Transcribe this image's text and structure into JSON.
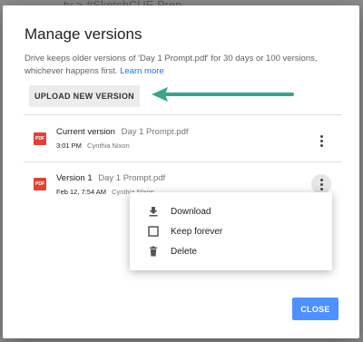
{
  "background": {
    "breadcrumb": "ty  >  #SketchCUE Prep"
  },
  "dialog": {
    "title": "Manage versions",
    "description": "Drive keeps older versions of 'Day 1 Prompt.pdf' for 30 days or 100 versions, whichever happens first.",
    "learn_more": "Learn more",
    "upload_button": "UPLOAD NEW VERSION",
    "annotation_arrow_color": "#3aa58c",
    "versions": [
      {
        "label": "Current version",
        "filename": "Day 1 Prompt.pdf",
        "time": "3:01 PM",
        "author": "Cynthia Nixon",
        "icon": "pdf-icon",
        "icon_text": "PDF"
      },
      {
        "label": "Version 1",
        "filename": "Day 1 Prompt.pdf",
        "time": "Feb 12, 7:54 AM",
        "author": "Cynthia Nixon",
        "icon": "pdf-icon",
        "icon_text": "PDF"
      }
    ],
    "menu": {
      "items": [
        {
          "label": "Download",
          "icon": "download-icon"
        },
        {
          "label": "Keep forever",
          "icon": "checkbox-icon"
        },
        {
          "label": "Delete",
          "icon": "trash-icon"
        }
      ]
    },
    "close_button": "CLOSE",
    "colors": {
      "pdf_red": "#db4437",
      "close_blue": "#4d90fe",
      "link_blue": "#1a73e8"
    }
  }
}
